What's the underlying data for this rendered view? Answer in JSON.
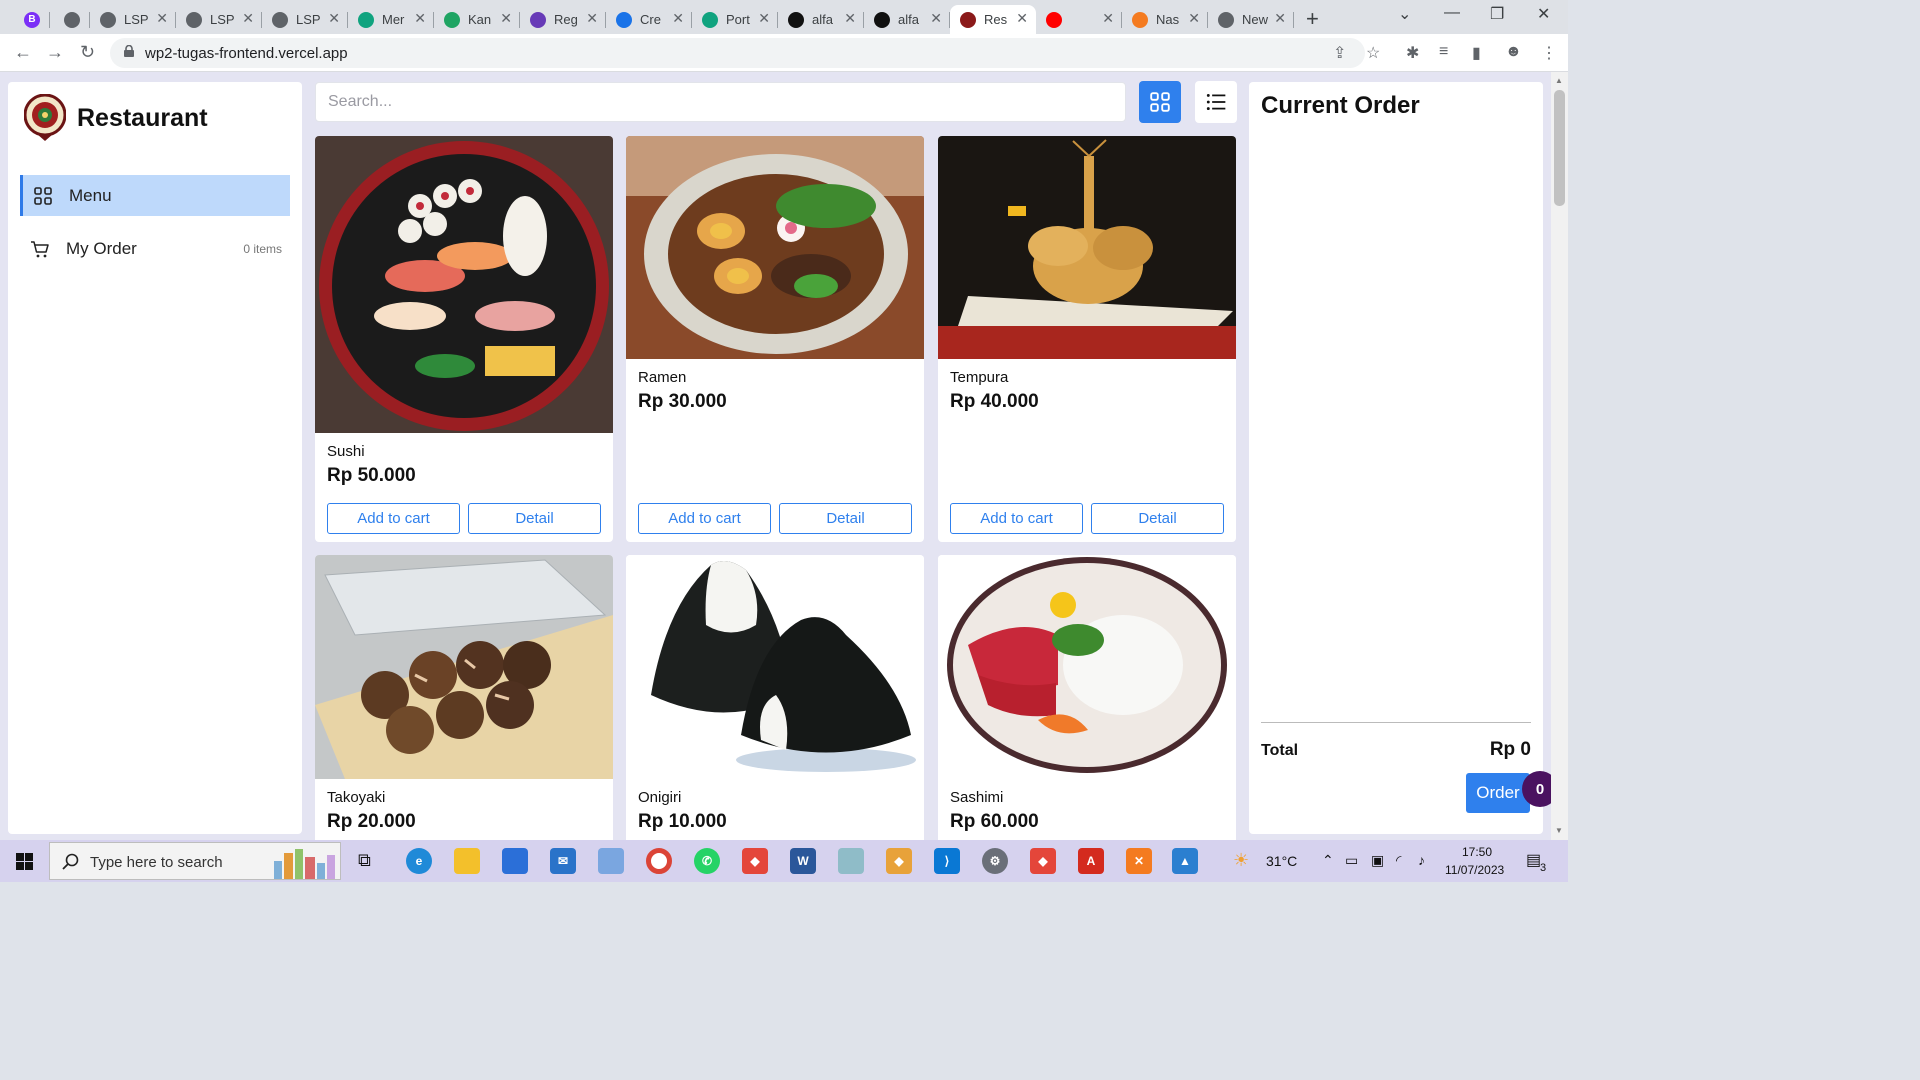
{
  "browser": {
    "tabs": [
      {
        "label": "B",
        "favicon_color": "#7b2ff7",
        "favicon_text": "B"
      },
      {
        "label": "",
        "favicon_color": "#5f6368"
      },
      {
        "label": "LSP",
        "favicon_color": "#5f6368"
      },
      {
        "label": "LSP",
        "favicon_color": "#5f6368"
      },
      {
        "label": "LSP",
        "favicon_color": "#5f6368"
      },
      {
        "label": "Mer",
        "favicon_color": "#10a37f"
      },
      {
        "label": "Kan",
        "favicon_color": "#1fa463"
      },
      {
        "label": "Reg",
        "favicon_color": "#673ab7"
      },
      {
        "label": "Cre",
        "favicon_color": "#1a73e8"
      },
      {
        "label": "Port",
        "favicon_color": "#10a37f"
      },
      {
        "label": "alfa",
        "favicon_color": "#111111"
      },
      {
        "label": "alfa",
        "favicon_color": "#111111"
      },
      {
        "label": "Res",
        "favicon_color": "#8b1a1a"
      },
      {
        "label": "",
        "favicon_color": "#ff0000"
      },
      {
        "label": "Nas",
        "favicon_color": "#f47b20"
      },
      {
        "label": "New",
        "favicon_color": "#5f6368"
      }
    ],
    "close_glyph": "✕",
    "new_tab": "+",
    "url": "wp2-tugas-frontend.vercel.app"
  },
  "app": {
    "brand": "Restaurant",
    "nav": [
      {
        "label": "Menu",
        "icon": "grid-icon",
        "active": true
      },
      {
        "label": "My Order",
        "icon": "cart-icon",
        "count": "0 items",
        "active": false
      }
    ],
    "search_placeholder": "Search...",
    "menu_items": [
      {
        "name": "Sushi",
        "price": "Rp 50.000"
      },
      {
        "name": "Ramen",
        "price": "Rp 30.000"
      },
      {
        "name": "Tempura",
        "price": "Rp 40.000"
      },
      {
        "name": "Takoyaki",
        "price": "Rp 20.000"
      },
      {
        "name": "Onigiri",
        "price": "Rp 10.000"
      },
      {
        "name": "Sashimi",
        "price": "Rp 60.000"
      }
    ],
    "add_to_cart_label": "Add to cart",
    "detail_label": "Detail",
    "order_panel": {
      "title": "Current Order",
      "total_label": "Total",
      "total_value": "Rp 0",
      "order_button": "Order",
      "order_count": "0"
    },
    "accent_color": "#2f80ed",
    "active_nav_color": "#bed9fb"
  },
  "taskbar": {
    "search_placeholder": "Type here to search",
    "temperature": "31°C",
    "time": "17:50",
    "date": "11/07/2023",
    "notifications": "3"
  }
}
